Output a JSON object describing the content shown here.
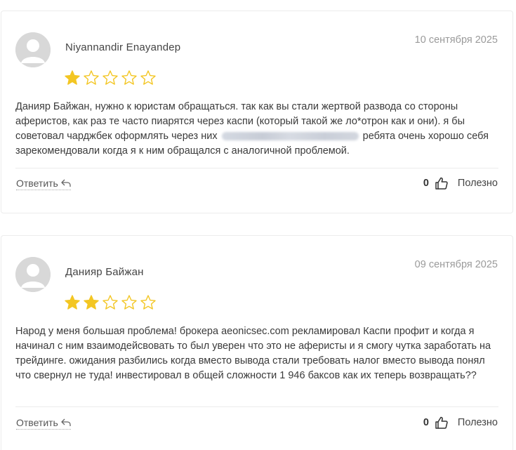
{
  "reviews": [
    {
      "author": "Niyannandir Enayandep",
      "date": "10 сентября 2025",
      "rating": 1,
      "max_rating": 5,
      "text_before": "Данияр Байжан, нужно к юристам обращаться. так как вы стали жертвой развода со стороны аферистов, как раз те часто пиарятся через каспи (который такой же ло*отрон как и они). я бы советовал чарджбек оформлять через них",
      "text_after": "ребята очень хорошо себя зарекомендовали когда я к ним обращался с аналогичной проблемой.",
      "reply_label": "Ответить",
      "helpful_count": "0",
      "helpful_label": "Полезно"
    },
    {
      "author": "Данияр Байжан",
      "date": "09 сентября 2025",
      "rating": 2,
      "max_rating": 5,
      "text": "Народ у меня большая проблема! брокера aeonicsec.com рекламировал Каспи профит и когда я начинал с ним взаимодейсвовать то был уверен что это не аферисты и я смогу чутка заработать на трейдинге. ожидания разбились когда вместо вывода стали требовать налог вместо вывода понял что свернул не туда! инвестировал в общей сложности 1 946 баксов как их теперь возвращать??",
      "reply_label": "Ответить",
      "helpful_count": "0",
      "helpful_label": "Полезно"
    }
  ],
  "colors": {
    "star_filled": "#f3c623",
    "star_empty_stroke": "#f3c623",
    "avatar_bg": "#d8d8d8",
    "border": "#ececec",
    "date": "#9a9a9a"
  },
  "icons": {
    "avatar": "user-avatar-placeholder",
    "star": "star-icon",
    "reply": "reply-arrow-icon",
    "thumb": "thumbs-up-icon"
  }
}
